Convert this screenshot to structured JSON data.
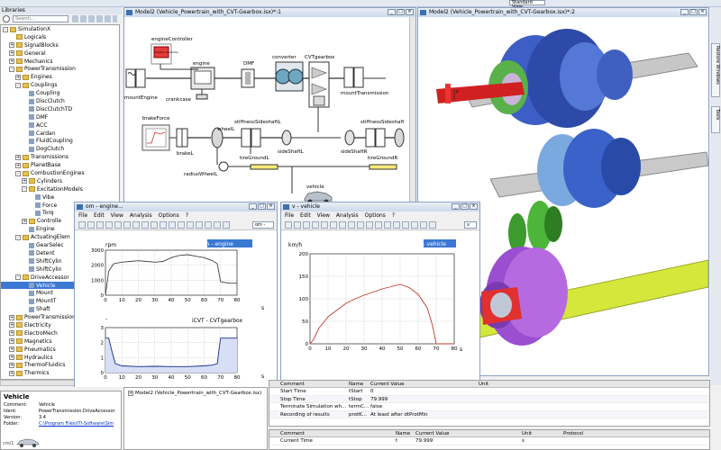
{
  "libraries": {
    "title": "Libraries",
    "search_placeholder": "Search..."
  },
  "tree": [
    {
      "label": "SimulationX",
      "exp": "-",
      "icon": "folder",
      "lvl": 0
    },
    {
      "label": "Logicals",
      "exp": "",
      "icon": "folder",
      "lvl": 1
    },
    {
      "label": "SignalBlocks",
      "exp": "+",
      "icon": "folder",
      "lvl": 1
    },
    {
      "label": "General",
      "exp": "+",
      "icon": "folder",
      "lvl": 1
    },
    {
      "label": "Mechanics",
      "exp": "+",
      "icon": "folder",
      "lvl": 1
    },
    {
      "label": "PowerTransmission",
      "exp": "-",
      "icon": "folder",
      "lvl": 1
    },
    {
      "label": "Engines",
      "exp": "+",
      "icon": "folder",
      "lvl": 2
    },
    {
      "label": "Couplings",
      "exp": "-",
      "icon": "folder",
      "lvl": 2
    },
    {
      "label": "Coupling",
      "exp": "",
      "icon": "comp",
      "lvl": 3
    },
    {
      "label": "DiscClutch",
      "exp": "",
      "icon": "comp",
      "lvl": 3
    },
    {
      "label": "DiscClutchTD",
      "exp": "",
      "icon": "comp",
      "lvl": 3
    },
    {
      "label": "DMF",
      "exp": "",
      "icon": "comp",
      "lvl": 3
    },
    {
      "label": "ACC",
      "exp": "",
      "icon": "comp",
      "lvl": 3
    },
    {
      "label": "Cardan",
      "exp": "",
      "icon": "comp",
      "lvl": 3
    },
    {
      "label": "FluidCoupling",
      "exp": "",
      "icon": "comp",
      "lvl": 3
    },
    {
      "label": "DogClutch",
      "exp": "",
      "icon": "comp",
      "lvl": 3
    },
    {
      "label": "Transmissions",
      "exp": "+",
      "icon": "folder",
      "lvl": 2
    },
    {
      "label": "PlanetBase",
      "exp": "+",
      "icon": "folder",
      "lvl": 2
    },
    {
      "label": "CombustionEngines",
      "exp": "-",
      "icon": "folder",
      "lvl": 2
    },
    {
      "label": "Cylinders",
      "exp": "+",
      "icon": "folder",
      "lvl": 3
    },
    {
      "label": "ExcitationModels",
      "exp": "-",
      "icon": "folder",
      "lvl": 3
    },
    {
      "label": "Vibe",
      "exp": "",
      "icon": "comp",
      "lvl": 4
    },
    {
      "label": "Force",
      "exp": "",
      "icon": "comp",
      "lvl": 4
    },
    {
      "label": "Torq",
      "exp": "",
      "icon": "comp",
      "lvl": 4
    },
    {
      "label": "Controlle",
      "exp": "+",
      "icon": "folder",
      "lvl": 3
    },
    {
      "label": "Engine",
      "exp": "",
      "icon": "comp",
      "lvl": 3
    },
    {
      "label": "ActuatingElem",
      "exp": "-",
      "icon": "folder",
      "lvl": 2
    },
    {
      "label": "GearSelec",
      "exp": "",
      "icon": "comp",
      "lvl": 3
    },
    {
      "label": "Detent",
      "exp": "",
      "icon": "comp",
      "lvl": 3
    },
    {
      "label": "ShiftCylin",
      "exp": "",
      "icon": "comp",
      "lvl": 3
    },
    {
      "label": "ShiftCylin",
      "exp": "",
      "icon": "comp",
      "lvl": 3
    },
    {
      "label": "DriveAccessor",
      "exp": "-",
      "icon": "folder",
      "lvl": 2
    },
    {
      "label": "Vehicle",
      "exp": "",
      "icon": "comp",
      "lvl": 3,
      "sel": true
    },
    {
      "label": "Mount",
      "exp": "",
      "icon": "comp",
      "lvl": 3
    },
    {
      "label": "MountT",
      "exp": "",
      "icon": "comp",
      "lvl": 3
    },
    {
      "label": "Shaft",
      "exp": "",
      "icon": "comp",
      "lvl": 3
    },
    {
      "label": "PowerTransmission",
      "exp": "+",
      "icon": "folder",
      "lvl": 1
    },
    {
      "label": "Electricity",
      "exp": "+",
      "icon": "folder",
      "lvl": 1
    },
    {
      "label": "ElectroMech",
      "exp": "+",
      "icon": "folder",
      "lvl": 1
    },
    {
      "label": "Magnetics",
      "exp": "+",
      "icon": "folder",
      "lvl": 1
    },
    {
      "label": "Pneumatics",
      "exp": "+",
      "icon": "folder",
      "lvl": 1
    },
    {
      "label": "Hydraulics",
      "exp": "+",
      "icon": "folder",
      "lvl": 1
    },
    {
      "label": "ThermoFluidics",
      "exp": "+",
      "icon": "folder",
      "lvl": 1
    },
    {
      "label": "Thermics",
      "exp": "+",
      "icon": "folder",
      "lvl": 1
    }
  ],
  "info": {
    "title": "Vehicle",
    "rows": [
      [
        "Comment:",
        "Vehicle"
      ],
      [
        "Ident:",
        "PowerTransmission.DriveAccessor"
      ],
      [
        "Version:",
        "3.4"
      ],
      [
        "Folder:",
        "C:\\Program Files\\ITI-Software\\Sim"
      ]
    ]
  },
  "model_window": {
    "title": "Model2 (Vehicle_Powertrain_with_CVT-Gearbox.isx)*:1"
  },
  "view3d_window": {
    "title": "Model2 (Vehicle_Powertrain_with_CVT-Gearbox.isx)*:2"
  },
  "top_tool": {
    "combo": "Standard View"
  },
  "side_tabs": [
    "Restore Windows",
    "Tools"
  ],
  "diagram": {
    "engineController": "engineController",
    "engineControllerBox": "Engine Controller",
    "engine": "engine",
    "crankcase": "crankcase",
    "mountEngine": "mountEngine",
    "DMF": "DMF",
    "converter": "converter",
    "CVTgearbox": "CVTgearbox",
    "mountTransmission": "mountTransmission",
    "brakeForce": "brakeForce",
    "brakeL": "brakeL",
    "wheelL": "wheelL",
    "stiffnessSideshaftL": "stiffnessSideshaftL",
    "stiffnessSideshaft": "stiffnessSideshaft",
    "tireGroundL": "tireGroundL",
    "sideShaftL": "sideShaftL",
    "sideShaftR": "sideShaftR",
    "tireGroundR": "tireGroundR",
    "radiusWheelL": "radiusWheelL",
    "vehicle": "vehicle"
  },
  "plot1": {
    "title": "om - engine...",
    "menu": [
      "File",
      "Edit",
      "View",
      "Analysis",
      "Options",
      "?"
    ],
    "combo": "om -",
    "ylabel1": "rpm",
    "legend1": "om - engine",
    "ylabel2": "-",
    "legend2": "iCVT - CVTgearbox",
    "xunit": "s",
    "y1ticks": [
      "3000",
      "2000",
      "1000",
      "0"
    ],
    "y2ticks": [
      "3",
      "2",
      "1",
      "0"
    ],
    "xticks": [
      "0",
      "10",
      "20",
      "30",
      "40",
      "50",
      "60",
      "70",
      "80"
    ]
  },
  "plot2": {
    "title": "v - vehicle",
    "menu": [
      "File",
      "Edit",
      "View",
      "Analysis",
      "Options",
      "?"
    ],
    "combo": "v",
    "ylabel": "km/h",
    "legend": "v - vehicle",
    "xunit": "s",
    "yticks": [
      "200",
      "150",
      "100",
      "50",
      "0"
    ],
    "xticks": [
      "0",
      "10",
      "20",
      "30",
      "40",
      "50",
      "60",
      "70",
      "80"
    ]
  },
  "chart_data": [
    {
      "type": "line",
      "ylabel": "rpm",
      "series": [
        {
          "name": "om - engine",
          "x": [
            0,
            2,
            5,
            10,
            15,
            20,
            25,
            30,
            35,
            40,
            45,
            50,
            55,
            60,
            65,
            68,
            70,
            75,
            80
          ],
          "y": [
            0,
            1600,
            2100,
            2200,
            2250,
            2300,
            2250,
            2200,
            2250,
            2500,
            2650,
            2700,
            2600,
            2500,
            2300,
            2100,
            900,
            800,
            800
          ]
        }
      ],
      "ylim": [
        0,
        3000
      ],
      "xlim": [
        0,
        80
      ]
    },
    {
      "type": "line",
      "ylabel": "-",
      "series": [
        {
          "name": "iCVT - CVTgearbox",
          "x": [
            0,
            2,
            4,
            6,
            10,
            20,
            30,
            40,
            50,
            60,
            65,
            68,
            69,
            70,
            72,
            75,
            80
          ],
          "y": [
            2.3,
            2.3,
            1.4,
            0.6,
            0.45,
            0.4,
            0.42,
            0.4,
            0.4,
            0.45,
            0.5,
            0.6,
            1.5,
            2.3,
            2.3,
            2.3,
            2.3
          ],
          "fill": true
        }
      ],
      "ylim": [
        0,
        3
      ],
      "xlim": [
        0,
        80
      ]
    },
    {
      "type": "line",
      "ylabel": "km/h",
      "series": [
        {
          "name": "v - vehicle",
          "x": [
            0,
            2,
            5,
            10,
            15,
            20,
            25,
            30,
            35,
            40,
            45,
            50,
            55,
            60,
            65,
            68,
            70,
            75,
            80
          ],
          "y": [
            0,
            10,
            35,
            60,
            75,
            90,
            100,
            108,
            115,
            122,
            127,
            132,
            125,
            110,
            80,
            40,
            0,
            0,
            0
          ]
        }
      ],
      "ylim": [
        0,
        200
      ],
      "xlim": [
        0,
        80
      ]
    }
  ],
  "props1": {
    "headers": [
      "Comment",
      "Name",
      "Current Value",
      "Unit"
    ],
    "rows": [
      [
        "Start Time",
        "tStart",
        "0",
        ""
      ],
      [
        "Stop Time",
        "tStop",
        "79.999",
        ""
      ],
      [
        "Terminate Simulation wh...",
        "termC...",
        "false",
        ""
      ],
      [
        "Recording of results",
        "protK...",
        "At least after dtProtMin",
        ""
      ]
    ]
  },
  "props2": {
    "headers": [
      "Comment",
      "Name",
      "Current Value",
      "Unit",
      "Protocol"
    ],
    "rows": [
      [
        "Current Time",
        "t",
        "79.999",
        "s",
        ""
      ]
    ]
  },
  "model_tree": {
    "label": "Model2 (Vehicle_Powertrain_with_CVT-Gearbox.isx)"
  },
  "status": {
    "zoom": "cm/1"
  }
}
